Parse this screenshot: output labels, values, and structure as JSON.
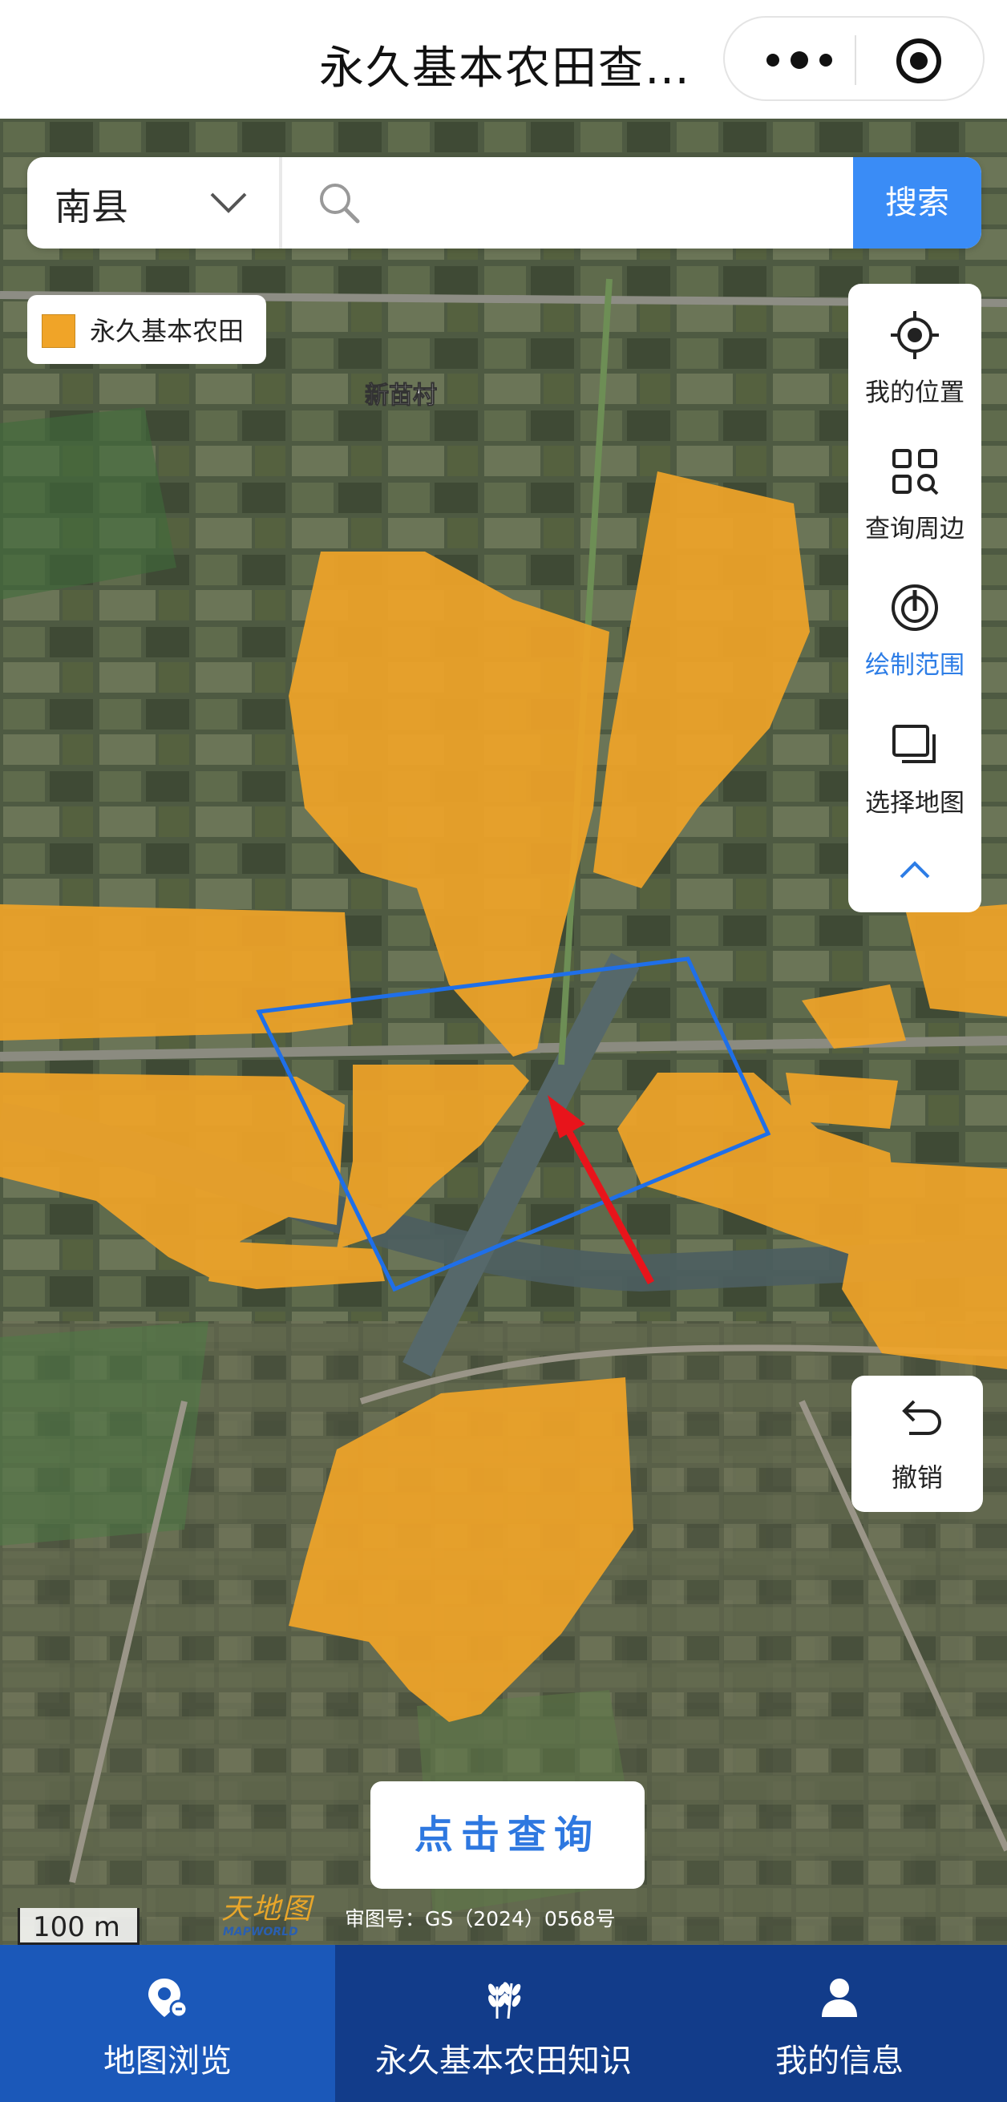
{
  "title": "永久基本农田查…",
  "search": {
    "region": "南县",
    "placeholder": "",
    "button": "搜索"
  },
  "legend": {
    "label": "永久基本农田",
    "color": "#f0a428"
  },
  "map": {
    "village_label": "新苗村",
    "scale": "100 m",
    "attribution_logo": "天地图",
    "attribution_logo_en": "MAPWORLD",
    "approval_number": "审图号：GS（2024）0568号"
  },
  "toolbar": {
    "items": [
      {
        "label": "我的位置",
        "icon": "locate-icon"
      },
      {
        "label": "查询周边",
        "icon": "grid-search-icon"
      },
      {
        "label": "绘制范围",
        "icon": "draw-area-icon",
        "active": true
      },
      {
        "label": "选择地图",
        "icon": "layers-icon"
      }
    ],
    "collapse_icon": "chevron-up-icon"
  },
  "undo": {
    "label": "撤销",
    "icon": "undo-icon"
  },
  "query_button": "点击查询",
  "bottom_nav": [
    {
      "label": "地图浏览",
      "icon": "map-pin-icon",
      "active": true
    },
    {
      "label": "永久基本农田知识",
      "icon": "wheat-icon",
      "active": false
    },
    {
      "label": "我的信息",
      "icon": "user-icon",
      "active": false
    }
  ],
  "colors": {
    "accent": "#3a8cf6",
    "farmland": "#f0a428",
    "draw_outline": "#1f6fe8",
    "arrow": "#e8141b",
    "nav_bg": "#123c8a",
    "nav_active": "#1b58b9"
  }
}
